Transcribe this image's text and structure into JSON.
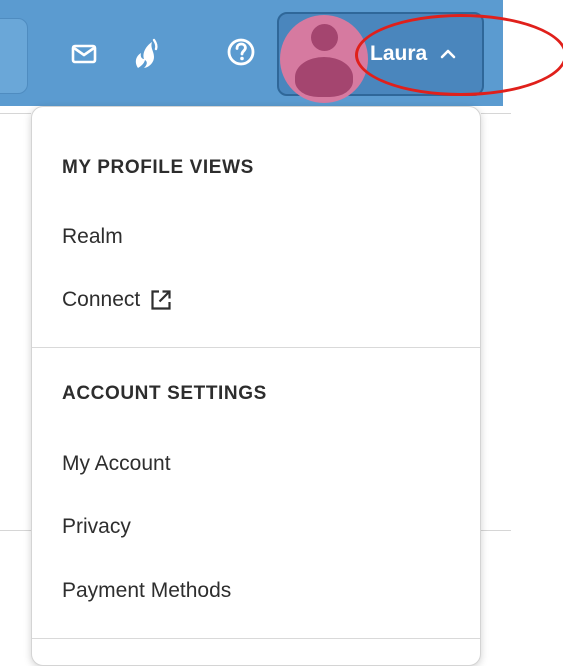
{
  "header": {
    "icons": {
      "mail": "mail-icon",
      "flame": "flame-icon",
      "help": "help-icon"
    },
    "user": {
      "name": "Laura",
      "caret": "chevron-up-icon"
    }
  },
  "dropdown": {
    "sections": [
      {
        "title": "MY PROFILE VIEWS",
        "items": [
          {
            "label": "Realm"
          },
          {
            "label": "Connect",
            "icon": "external-link-icon"
          }
        ]
      },
      {
        "title": "ACCOUNT SETTINGS",
        "items": [
          {
            "label": "My Account"
          },
          {
            "label": "Privacy"
          },
          {
            "label": "Payment Methods"
          }
        ]
      }
    ]
  },
  "colors": {
    "header_bg": "#5b9bd0",
    "profile_selected_bg": "#4a86bd",
    "avatar_bg": "#d67aa0",
    "annotation": "#e0201b"
  }
}
